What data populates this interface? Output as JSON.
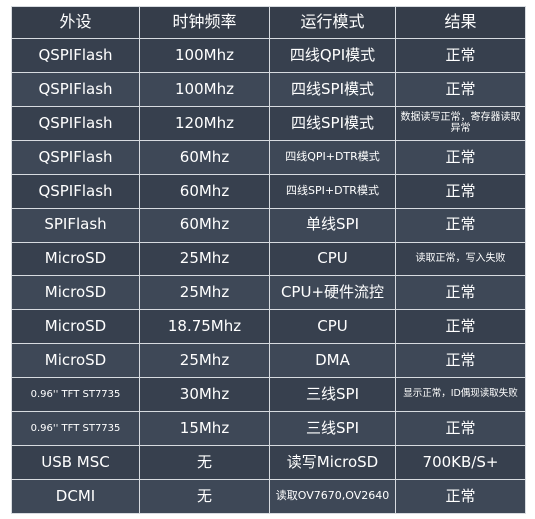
{
  "table": {
    "headers": [
      "外设",
      "时钟频率",
      "运行模式",
      "结果"
    ],
    "rows": [
      {
        "peripheral": "QSPIFlash",
        "clock": "100Mhz",
        "mode": "四线QPI模式",
        "result": "正常"
      },
      {
        "peripheral": "QSPIFlash",
        "clock": "100Mhz",
        "mode": "四线SPI模式",
        "result": "正常"
      },
      {
        "peripheral": "QSPIFlash",
        "clock": "120Mhz",
        "mode": "四线SPI模式",
        "result": "数据读写正常，寄存器读取异常"
      },
      {
        "peripheral": "QSPIFlash",
        "clock": "60Mhz",
        "mode": "四线QPI+DTR模式",
        "result": "正常"
      },
      {
        "peripheral": "QSPIFlash",
        "clock": "60Mhz",
        "mode": "四线SPI+DTR模式",
        "result": "正常"
      },
      {
        "peripheral": "SPIFlash",
        "clock": "60Mhz",
        "mode": "单线SPI",
        "result": "正常"
      },
      {
        "peripheral": "MicroSD",
        "clock": "25Mhz",
        "mode": "CPU",
        "result": "读取正常，写入失败"
      },
      {
        "peripheral": "MicroSD",
        "clock": "25Mhz",
        "mode": "CPU+硬件流控",
        "result": "正常"
      },
      {
        "peripheral": "MicroSD",
        "clock": "18.75Mhz",
        "mode": "CPU",
        "result": "正常"
      },
      {
        "peripheral": "MicroSD",
        "clock": "25Mhz",
        "mode": "DMA",
        "result": "正常"
      },
      {
        "peripheral": "0.96'' TFT ST7735",
        "clock": "30Mhz",
        "mode": "三线SPI",
        "result": "显示正常，ID偶现读取失败"
      },
      {
        "peripheral": "0.96'' TFT ST7735",
        "clock": "15Mhz",
        "mode": "三线SPI",
        "result": "正常"
      },
      {
        "peripheral": "USB MSC",
        "clock": "无",
        "mode": "读写MicroSD",
        "result": "700KB/S+"
      },
      {
        "peripheral": "DCMI",
        "clock": "无",
        "mode": "读取OV7670,OV2640",
        "result": "正常"
      }
    ]
  },
  "colors": {
    "background": "#37404e",
    "row_alt": "#3e4857",
    "border": "#d7dbe0",
    "text": "#ffffff"
  }
}
